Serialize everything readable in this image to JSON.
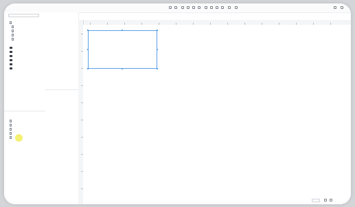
{
  "colors": {
    "accent": "#4a8ad8",
    "selection": "#5aa0e8",
    "cursor_highlight": "#f2ef6b",
    "folder": "#3a3f47"
  },
  "icons": {
    "folder": "folder-icon",
    "file": "file-icon",
    "cursor": "cursor-highlight",
    "search": "search-icon"
  },
  "right_toolbar_small_count": 14
}
